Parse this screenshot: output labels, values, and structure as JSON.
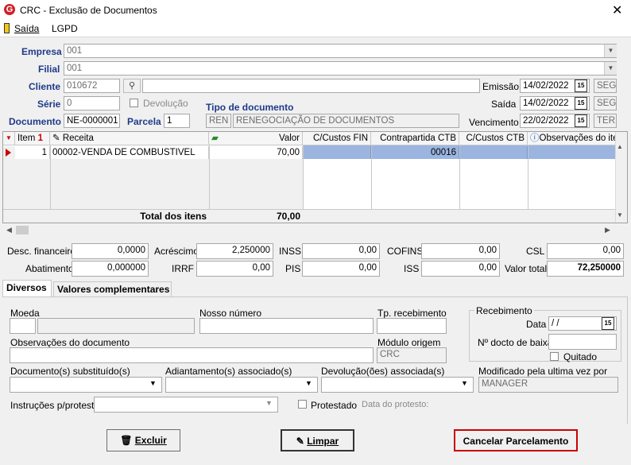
{
  "window": {
    "title": "CRC - Exclusão de Documentos",
    "icon_letter": "G",
    "close": "✕"
  },
  "menu": {
    "exit": "Saída",
    "lgpd": "LGPD"
  },
  "header": {
    "empresa_label": "Empresa",
    "empresa_value": "001",
    "filial_label": "Filial",
    "filial_value": "001",
    "cliente_label": "Cliente",
    "cliente_value": "010672",
    "cliente_name": "",
    "emissao_label": "Emissão",
    "emissao_value": "14/02/2022",
    "emissao_day": "SEG",
    "serie_label": "Série",
    "serie_value": "0",
    "devolucao_label": "Devolução",
    "saida_label": "Saída",
    "saida_value": "14/02/2022",
    "saida_day": "SEG",
    "tipo_label": "Tipo de documento",
    "tipo_code": "REN",
    "tipo_desc": "RENEGOCIAÇÃO DE DOCUMENTOS",
    "documento_label": "Documento",
    "documento_value": "NE-0000001",
    "parcela_label": "Parcela",
    "parcela_value": "1",
    "vencimento_label": "Vencimento",
    "vencimento_value": "22/02/2022",
    "vencimento_day": "TER",
    "cal_icon": "15"
  },
  "grid": {
    "columns": {
      "item": "Item",
      "item_sort": "1",
      "receita": "Receita",
      "valor": "Valor",
      "ccfin": "C/Custos FIN",
      "contrapartida": "Contrapartida CTB",
      "ccctb": "C/Custos CTB",
      "obs": "Observações do ite"
    },
    "rows": [
      {
        "item": "1",
        "receita": "00002-VENDA DE COMBUSTIVEL",
        "valor": "70,00",
        "ccfin": "",
        "contrapartida": "00016",
        "ccctb": "",
        "obs": ""
      }
    ],
    "total_label": "Total dos itens",
    "total_value": "70,00"
  },
  "totals": {
    "desc_fin_label": "Desc. financeiro",
    "desc_fin": "0,0000",
    "acrescimo_label": "Acréscimo",
    "acrescimo": "2,250000",
    "inss_label": "INSS",
    "inss": "0,00",
    "cofins_label": "COFINS",
    "cofins": "0,00",
    "csl_label": "CSL",
    "csl": "0,00",
    "abatimento_label": "Abatimento",
    "abatimento": "0,000000",
    "irrf_label": "IRRF",
    "irrf": "0,00",
    "pis_label": "PIS",
    "pis": "0,00",
    "iss_label": "ISS",
    "iss": "0,00",
    "valor_total_label": "Valor total",
    "valor_total": "72,250000"
  },
  "tabs": [
    {
      "label": "Diversos"
    },
    {
      "label": "Valores complementares"
    }
  ],
  "diversos": {
    "moeda_label": "Moeda",
    "nosso_numero_label": "Nosso número",
    "tp_recebimento_label": "Tp. recebimento",
    "recebimento_group": "Recebimento",
    "data_label": "Data",
    "data_value": " /  /",
    "nr_docto_label": "Nº docto de baixa",
    "quitado_label": "Quitado",
    "obs_label": "Observações do documento",
    "modulo_label": "Módulo origem",
    "modulo_value": "CRC",
    "doc_subst_label": "Documento(s) substituído(s)",
    "adiant_label": "Adiantamento(s) associado(s)",
    "devol_label": "Devolução(ões) associada(s)",
    "modificado_label": "Modificado pela ultima vez por",
    "modificado_value": "MANAGER",
    "instrucoes_label": "Instruções p/protesto",
    "protestado_label": "Protestado",
    "data_protesto_label": "Data do protesto:"
  },
  "buttons": {
    "excluir": "Excluir",
    "limpar": "Limpar",
    "cancelar": "Cancelar Parcelamento"
  },
  "colors": {
    "accent": "#1f3a8a",
    "highlight": "#cc0000",
    "selection": "#9bb5e0"
  }
}
